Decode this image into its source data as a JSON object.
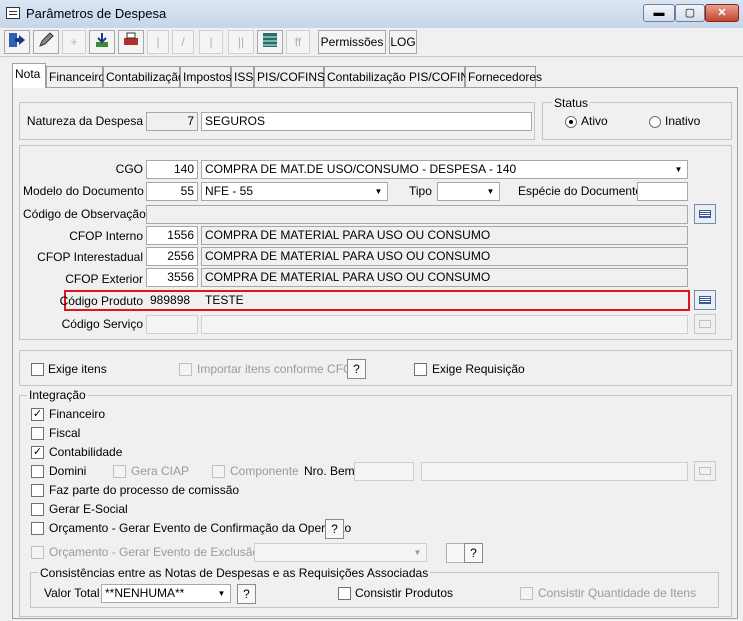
{
  "window": {
    "title": "Parâmetros de Despesa",
    "minimize": "▬",
    "maximize": "▢",
    "close": "✕"
  },
  "toolbar": {
    "permissoes": "Permissões",
    "log": "LOG"
  },
  "tabs": [
    "Nota",
    "Financeiro",
    "Contabilização",
    "Impostos",
    "ISS",
    "PIS/COFINS",
    "Contabilização PIS/COFINS",
    "Fornecedores"
  ],
  "natureza": {
    "label": "Natureza da Despesa",
    "code": "7",
    "value": "SEGUROS"
  },
  "status": {
    "label": "Status",
    "ativo": "Ativo",
    "inativo": "Inativo",
    "selected": "Ativo"
  },
  "cgo": {
    "label": "CGO",
    "code": "140",
    "value": "COMPRA DE MAT.DE USO/CONSUMO - DESPESA - 140"
  },
  "modelo": {
    "label": "Modelo do Documento",
    "code": "55",
    "value": "NFE - 55"
  },
  "tipo": {
    "label": "Tipo",
    "value": ""
  },
  "especie": {
    "label": "Espécie do Documento",
    "value": ""
  },
  "observacao": {
    "label": "Código de Observação"
  },
  "cfop_interno": {
    "label": "CFOP Interno",
    "code": "1556",
    "value": "COMPRA DE MATERIAL PARA USO OU CONSUMO"
  },
  "cfop_interestadual": {
    "label": "CFOP Interestadual",
    "code": "2556",
    "value": "COMPRA DE MATERIAL PARA USO OU CONSUMO"
  },
  "cfop_exterior": {
    "label": "CFOP Exterior",
    "code": "3556",
    "value": "COMPRA DE MATERIAL PARA USO OU CONSUMO"
  },
  "produto": {
    "label": "Código Produto",
    "code": "989898",
    "value": "TESTE"
  },
  "servico": {
    "label": "Código Serviço"
  },
  "exige_itens": {
    "label": "Exige itens",
    "checked": false
  },
  "importar_itens": {
    "label": "Importar itens conforme CFOP",
    "checked": false
  },
  "exige_requisicao": {
    "label": "Exige Requisição",
    "checked": false
  },
  "help": "?",
  "check_mark": "✓",
  "combo_arrow": "▼",
  "integracao": {
    "label": "Integração",
    "financeiro": {
      "label": "Financeiro",
      "checked": true
    },
    "fiscal": {
      "label": "Fiscal",
      "checked": false
    },
    "contabilidade": {
      "label": "Contabilidade",
      "checked": true
    },
    "domini": {
      "label": "Domini",
      "checked": false
    },
    "gera_ciap": {
      "label": "Gera CIAP",
      "checked": false
    },
    "componente": {
      "label": "Componente",
      "checked": false
    },
    "nro_bem": "Nro. Bem",
    "comissao": {
      "label": "Faz parte do processo de comissão",
      "checked": false
    },
    "esocial": {
      "label": "Gerar E-Social",
      "checked": false
    },
    "orcamento_confirmacao": {
      "label": "Orçamento - Gerar Evento de Confirmação da Operação",
      "checked": false
    },
    "orcamento_exclusao": {
      "label": "Orçamento - Gerar Evento de Exclusão",
      "checked": false
    }
  },
  "consistencias": {
    "label": "Consistências entre as Notas de Despesas e as Requisições Associadas",
    "valor_total_label": "Valor Total",
    "valor_total": "**NENHUMA**",
    "consistir_produtos": "Consistir Produtos",
    "consistir_quantidade": "Consistir Quantidade de Itens"
  }
}
